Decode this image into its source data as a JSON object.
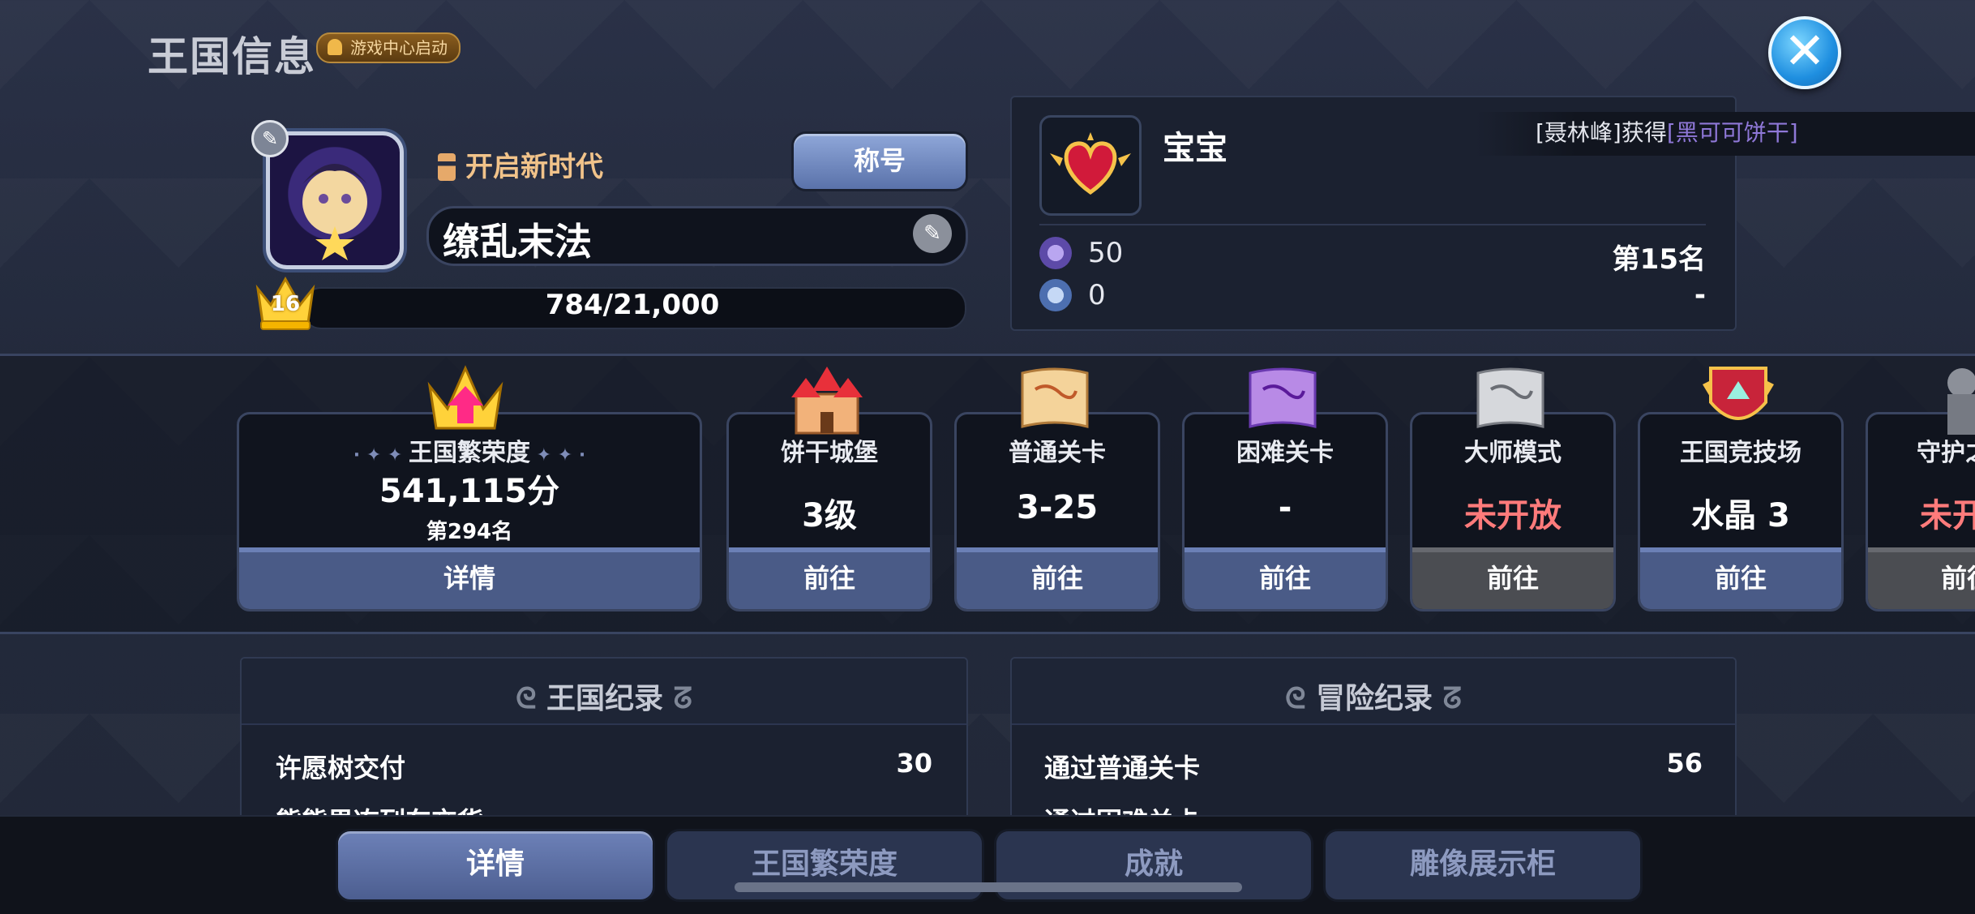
{
  "header": {
    "title": "王国信息",
    "launch_badge": "游戏中心启动",
    "close_icon": "close-icon"
  },
  "profile": {
    "era": "开启新时代",
    "title_button": "称号",
    "name": "缭乱末法",
    "level": "16",
    "xp": "784/21,000"
  },
  "guild": {
    "name": "宝宝",
    "ticker": {
      "prefix": "[聂林峰]获得",
      "highlight": "[黑可可饼干]"
    },
    "stats": [
      {
        "icon": "trophy-purple-icon",
        "value": "50",
        "rank": "第15名"
      },
      {
        "icon": "trophy-blue-icon",
        "value": "0",
        "rank": "-"
      }
    ]
  },
  "cards": [
    {
      "title": "王国繁荣度",
      "value": "541,115分",
      "sub": "第294名",
      "button": "详情",
      "icon": "crown-icon"
    },
    {
      "title": "饼干城堡",
      "value": "3级",
      "button": "前往",
      "icon": "castle-icon"
    },
    {
      "title": "普通关卡",
      "value": "3-25",
      "button": "前往",
      "icon": "map-icon"
    },
    {
      "title": "困难关卡",
      "value": "-",
      "button": "前往",
      "icon": "hard-map-icon"
    },
    {
      "title": "大师模式",
      "value": "未开放",
      "button": "前往",
      "icon": "master-map-icon"
    },
    {
      "title": "王国竞技场",
      "value": "水晶 3",
      "button": "前往",
      "icon": "arena-shield-icon"
    },
    {
      "title": "守护之",
      "value": "未开",
      "button": "前往",
      "icon": "guardian-statue-icon"
    }
  ],
  "records": {
    "kingdom": {
      "title": "王国纪录",
      "rows": [
        {
          "label": "许愿树交付",
          "value": "30"
        },
        {
          "label": "熊熊果冻列车交货",
          "value": ""
        }
      ]
    },
    "adventure": {
      "title": "冒险纪录",
      "rows": [
        {
          "label": "通过普通关卡",
          "value": "56"
        },
        {
          "label": "通过困难关卡",
          "value": ""
        }
      ]
    }
  },
  "tabs": [
    {
      "label": "详情"
    },
    {
      "label": "王国繁荣度"
    },
    {
      "label": "成就"
    },
    {
      "label": "雕像展示柜"
    }
  ],
  "colors": {
    "accent": "#4a5b87",
    "value_red": "#ff7b7b",
    "ticker_highlight": "#8f78d8",
    "era_gold": "#f1c38a"
  }
}
